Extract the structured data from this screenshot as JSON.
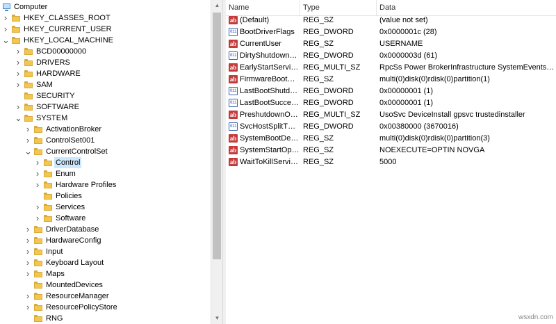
{
  "tree": {
    "items": [
      {
        "label": "Computer",
        "icon": "computer-icon"
      },
      {
        "label": "HKEY_CLASSES_ROOT",
        "expander": ">"
      },
      {
        "label": "HKEY_CURRENT_USER",
        "expander": ">"
      },
      {
        "label": "HKEY_LOCAL_MACHINE",
        "expander": "v"
      },
      {
        "label": "BCD00000000",
        "expander": ">"
      },
      {
        "label": "DRIVERS",
        "expander": ">"
      },
      {
        "label": "HARDWARE",
        "expander": ">"
      },
      {
        "label": "SAM",
        "expander": ">"
      },
      {
        "label": "SECURITY",
        "expander": ""
      },
      {
        "label": "SOFTWARE",
        "expander": ">"
      },
      {
        "label": "SYSTEM",
        "expander": "v"
      },
      {
        "label": "ActivationBroker",
        "expander": ">"
      },
      {
        "label": "ControlSet001",
        "expander": ">"
      },
      {
        "label": "CurrentControlSet",
        "expander": "v"
      },
      {
        "label": "Control",
        "expander": ">",
        "selected": true
      },
      {
        "label": "Enum",
        "expander": ">"
      },
      {
        "label": "Hardware Profiles",
        "expander": ">"
      },
      {
        "label": "Policies",
        "expander": ""
      },
      {
        "label": "Services",
        "expander": ">"
      },
      {
        "label": "Software",
        "expander": ">"
      },
      {
        "label": "DriverDatabase",
        "expander": ">"
      },
      {
        "label": "HardwareConfig",
        "expander": ">"
      },
      {
        "label": "Input",
        "expander": ">"
      },
      {
        "label": "Keyboard Layout",
        "expander": ">"
      },
      {
        "label": "Maps",
        "expander": ">"
      },
      {
        "label": "MountedDevices",
        "expander": ""
      },
      {
        "label": "ResourceManager",
        "expander": ">"
      },
      {
        "label": "ResourcePolicyStore",
        "expander": ">"
      },
      {
        "label": "RNG",
        "expander": ""
      }
    ]
  },
  "values": {
    "headers": {
      "name": "Name",
      "type": "Type",
      "data": "Data"
    },
    "rows": [
      {
        "name": "(Default)",
        "type": "REG_SZ",
        "data": "(value not set)",
        "icon": "string-value-icon"
      },
      {
        "name": "BootDriverFlags",
        "type": "REG_DWORD",
        "data": "0x0000001c (28)",
        "icon": "dword-value-icon"
      },
      {
        "name": "CurrentUser",
        "type": "REG_SZ",
        "data": "USERNAME",
        "icon": "string-value-icon"
      },
      {
        "name": "DirtyShutdownC...",
        "type": "REG_DWORD",
        "data": "0x0000003d (61)",
        "icon": "dword-value-icon"
      },
      {
        "name": "EarlyStartServices",
        "type": "REG_MULTI_SZ",
        "data": "RpcSs Power BrokerInfrastructure SystemEventsBro...",
        "icon": "string-value-icon"
      },
      {
        "name": "FirmwareBootDe...",
        "type": "REG_SZ",
        "data": "multi(0)disk(0)rdisk(0)partition(1)",
        "icon": "string-value-icon"
      },
      {
        "name": "LastBootShutdo...",
        "type": "REG_DWORD",
        "data": "0x00000001 (1)",
        "icon": "dword-value-icon"
      },
      {
        "name": "LastBootSucceed...",
        "type": "REG_DWORD",
        "data": "0x00000001 (1)",
        "icon": "dword-value-icon"
      },
      {
        "name": "PreshutdownOrd...",
        "type": "REG_MULTI_SZ",
        "data": "UsoSvc DeviceInstall gpsvc trustedinstaller",
        "icon": "string-value-icon"
      },
      {
        "name": "SvcHostSplitThre...",
        "type": "REG_DWORD",
        "data": "0x00380000 (3670016)",
        "icon": "dword-value-icon"
      },
      {
        "name": "SystemBootDevi...",
        "type": "REG_SZ",
        "data": "multi(0)disk(0)rdisk(0)partition(3)",
        "icon": "string-value-icon"
      },
      {
        "name": "SystemStartOpti...",
        "type": "REG_SZ",
        "data": " NOEXECUTE=OPTIN  NOVGA",
        "icon": "string-value-icon"
      },
      {
        "name": "WaitToKillServic...",
        "type": "REG_SZ",
        "data": "5000",
        "icon": "string-value-icon"
      }
    ]
  },
  "watermark": "wsxdn.com",
  "colors": {
    "selection": "#cce8ff",
    "folder": "#f3c74f",
    "string_icon": "#c43b3b",
    "dword_icon": "#3a5fb0"
  }
}
